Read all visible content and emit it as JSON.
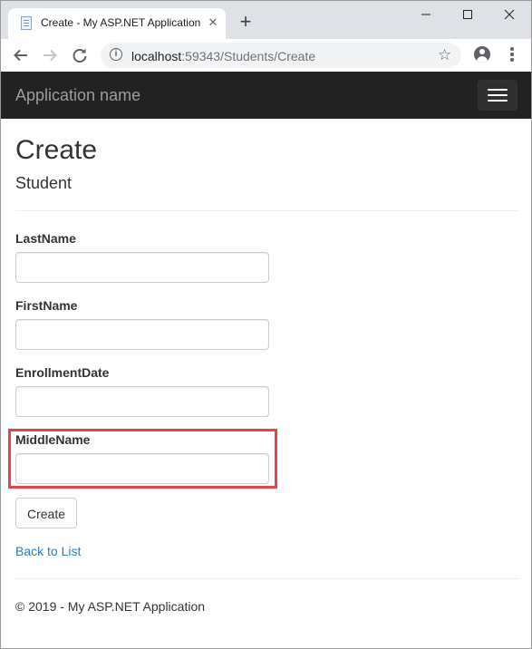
{
  "browser": {
    "tab_title": "Create - My ASP.NET Application",
    "url_host": "localhost",
    "url_rest": ":59343/Students/Create"
  },
  "navbar": {
    "brand": "Application name"
  },
  "page": {
    "title": "Create",
    "subtitle": "Student",
    "fields": [
      {
        "label": "LastName",
        "value": ""
      },
      {
        "label": "FirstName",
        "value": ""
      },
      {
        "label": "EnrollmentDate",
        "value": ""
      },
      {
        "label": "MiddleName",
        "value": ""
      }
    ],
    "create_button": "Create",
    "back_link": "Back to List",
    "footer": "© 2019 - My ASP.NET Application"
  },
  "colors": {
    "navbar_bg": "#222222",
    "link": "#337ab7",
    "highlight_border": "#e0474c"
  }
}
